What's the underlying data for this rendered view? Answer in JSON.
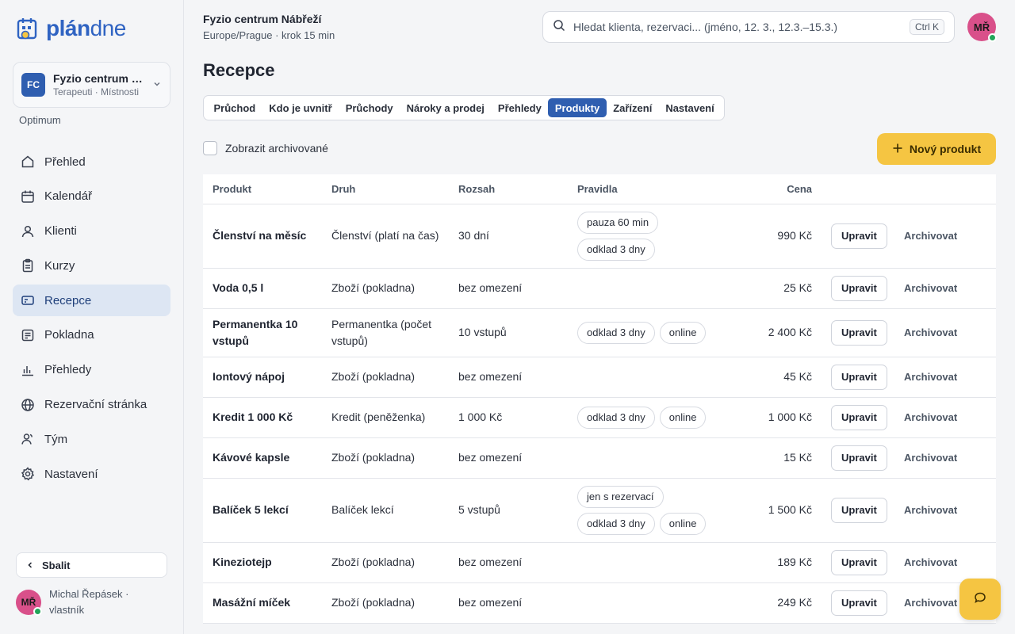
{
  "brand": {
    "logo_part1": "plán",
    "logo_part2": "dne",
    "accent": "#2f63c2",
    "cta_color": "#f5c542"
  },
  "org": {
    "initials": "FC",
    "name": "Fyzio centrum Nábřeží",
    "sub": "Terapeuti · Místnosti",
    "plan": "Optimum"
  },
  "nav": [
    {
      "label": "Přehled",
      "icon": "home-icon"
    },
    {
      "label": "Kalendář",
      "icon": "calendar-icon"
    },
    {
      "label": "Klienti",
      "icon": "user-icon"
    },
    {
      "label": "Kurzy",
      "icon": "clipboard-icon"
    },
    {
      "label": "Recepce",
      "icon": "card-icon",
      "active": true
    },
    {
      "label": "Pokladna",
      "icon": "register-icon"
    },
    {
      "label": "Přehledy",
      "icon": "bar-chart-icon"
    },
    {
      "label": "Rezervační stránka",
      "icon": "globe-icon"
    },
    {
      "label": "Tým",
      "icon": "team-icon"
    },
    {
      "label": "Nastavení",
      "icon": "gear-icon"
    }
  ],
  "sidebar_footer": {
    "collapse_label": "Sbalit",
    "user_initials": "MŘ",
    "user_name": "Michal Řepásek · vlastník"
  },
  "header": {
    "location_title": "Fyzio centrum Nábřeží",
    "location_sub": "Europe/Prague · krok 15 min",
    "search_placeholder": "Hledat klienta, rezervaci... (jméno, 12. 3., 12.3.–15.3.)",
    "search_shortcut": "Ctrl K",
    "user_initials": "MŘ"
  },
  "page": {
    "title": "Recepce",
    "tabs": [
      "Průchod",
      "Kdo je uvnitř",
      "Průchody",
      "Nároky a prodej",
      "Přehledy",
      "Produkty",
      "Zařízení",
      "Nastavení"
    ],
    "active_tab": "Produkty",
    "show_archived_label": "Zobrazit archivované",
    "new_product_label": "Nový produkt"
  },
  "table": {
    "columns": [
      "Produkt",
      "Druh",
      "Rozsah",
      "Pravidla",
      "Cena"
    ],
    "edit_label": "Upravit",
    "archive_label": "Archivovat",
    "rows": [
      {
        "name": "Členství na měsíc",
        "kind": "Členství (platí na čas)",
        "scope": "30 dní",
        "rules": [
          "pauza 60 min",
          "odklad 3 dny"
        ],
        "price": "990 Kč"
      },
      {
        "name": "Voda 0,5 l",
        "kind": "Zboží (pokladna)",
        "scope": "bez omezení",
        "rules": [],
        "price": "25 Kč"
      },
      {
        "name": "Permanentka 10 vstupů",
        "kind": "Permanentka (počet vstupů)",
        "scope": "10 vstupů",
        "rules": [
          "odklad 3 dny",
          "online"
        ],
        "price": "2 400 Kč"
      },
      {
        "name": "Iontový nápoj",
        "kind": "Zboží (pokladna)",
        "scope": "bez omezení",
        "rules": [],
        "price": "45 Kč"
      },
      {
        "name": "Kredit 1 000 Kč",
        "kind": "Kredit (peněženka)",
        "scope": "1 000 Kč",
        "rules": [
          "odklad 3 dny",
          "online"
        ],
        "price": "1 000 Kč"
      },
      {
        "name": "Kávové kapsle",
        "kind": "Zboží (pokladna)",
        "scope": "bez omezení",
        "rules": [],
        "price": "15 Kč"
      },
      {
        "name": "Balíček 5 lekcí",
        "kind": "Balíček lekcí",
        "scope": "5 vstupů",
        "rules": [
          "jen s rezervací",
          "odklad 3 dny",
          "online"
        ],
        "price": "1 500 Kč"
      },
      {
        "name": "Kineziotejp",
        "kind": "Zboží (pokladna)",
        "scope": "bez omezení",
        "rules": [],
        "price": "189 Kč"
      },
      {
        "name": "Masážní míček",
        "kind": "Zboží (pokladna)",
        "scope": "bez omezení",
        "rules": [],
        "price": "249 Kč"
      }
    ]
  }
}
